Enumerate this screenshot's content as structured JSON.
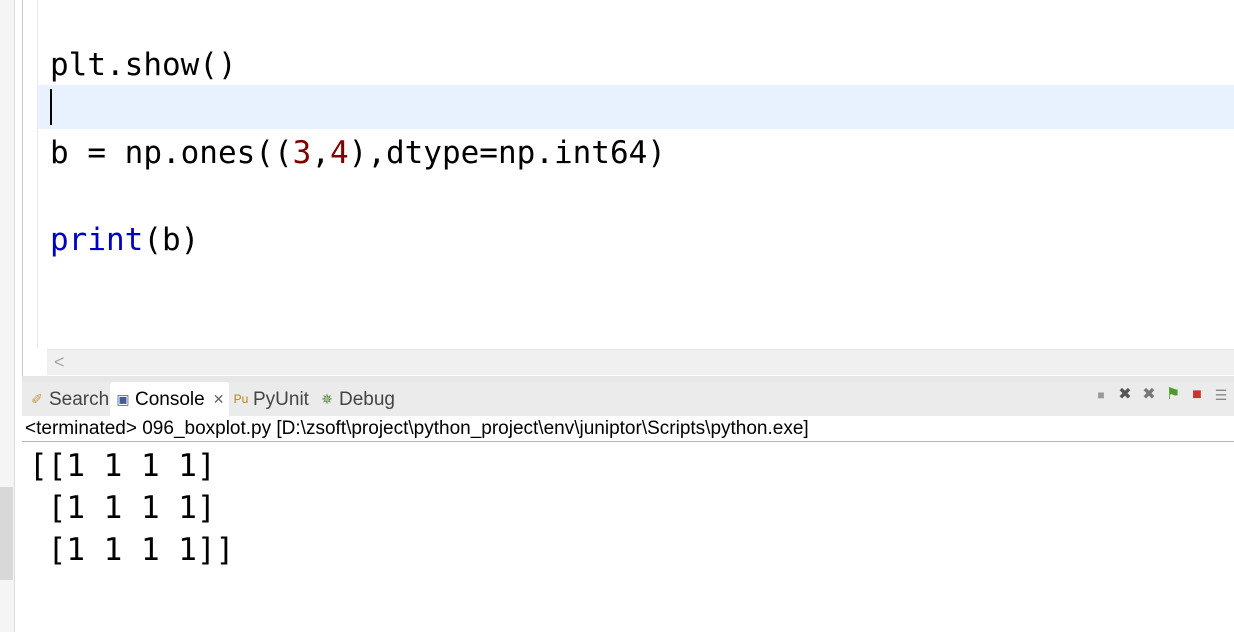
{
  "editor": {
    "lines": {
      "show": "plt.show()",
      "ones_prefix": "b = np.ones((",
      "ones_n1": "3",
      "ones_comma": ",",
      "ones_n2": "4",
      "ones_suffix": "),dtype=np.int64)",
      "print_kw": "print",
      "print_arg": "(b)"
    }
  },
  "hscroll": {
    "left_arrow": "<"
  },
  "console_tabs": [
    {
      "label": "Search",
      "icon": "search-icon"
    },
    {
      "label": "Console",
      "icon": "console-icon",
      "close": "✕"
    },
    {
      "label": "PyUnit",
      "icon": "pyunit-icon"
    },
    {
      "label": "Debug",
      "icon": "debug-icon"
    }
  ],
  "toolbar_icons": [
    "terminate-icon",
    "remove-launch-icon",
    "remove-all-icon",
    "pin-icon",
    "display-selected-console-icon",
    "open-console-icon"
  ],
  "console": {
    "header": "<terminated> 096_boxplot.py [D:\\zsoft\\project\\python_project\\env\\juniptor\\Scripts\\python.exe]",
    "output": [
      "[[1 1 1 1]",
      " [1 1 1 1]",
      " [1 1 1 1]]"
    ]
  },
  "colors": {
    "current_line": "#e8f2fe",
    "number": "#7f0000",
    "keyword": "#0000c0"
  }
}
